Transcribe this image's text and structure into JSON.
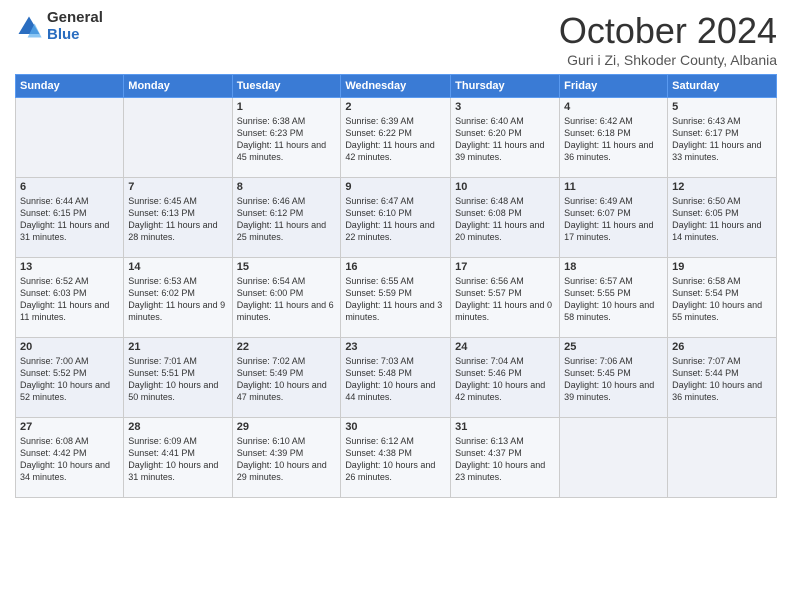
{
  "logo": {
    "general": "General",
    "blue": "Blue"
  },
  "header": {
    "month": "October 2024",
    "location": "Guri i Zi, Shkoder County, Albania"
  },
  "days_of_week": [
    "Sunday",
    "Monday",
    "Tuesday",
    "Wednesday",
    "Thursday",
    "Friday",
    "Saturday"
  ],
  "weeks": [
    [
      {
        "day": "",
        "info": ""
      },
      {
        "day": "",
        "info": ""
      },
      {
        "day": "1",
        "info": "Sunrise: 6:38 AM\nSunset: 6:23 PM\nDaylight: 11 hours and 45 minutes."
      },
      {
        "day": "2",
        "info": "Sunrise: 6:39 AM\nSunset: 6:22 PM\nDaylight: 11 hours and 42 minutes."
      },
      {
        "day": "3",
        "info": "Sunrise: 6:40 AM\nSunset: 6:20 PM\nDaylight: 11 hours and 39 minutes."
      },
      {
        "day": "4",
        "info": "Sunrise: 6:42 AM\nSunset: 6:18 PM\nDaylight: 11 hours and 36 minutes."
      },
      {
        "day": "5",
        "info": "Sunrise: 6:43 AM\nSunset: 6:17 PM\nDaylight: 11 hours and 33 minutes."
      }
    ],
    [
      {
        "day": "6",
        "info": "Sunrise: 6:44 AM\nSunset: 6:15 PM\nDaylight: 11 hours and 31 minutes."
      },
      {
        "day": "7",
        "info": "Sunrise: 6:45 AM\nSunset: 6:13 PM\nDaylight: 11 hours and 28 minutes."
      },
      {
        "day": "8",
        "info": "Sunrise: 6:46 AM\nSunset: 6:12 PM\nDaylight: 11 hours and 25 minutes."
      },
      {
        "day": "9",
        "info": "Sunrise: 6:47 AM\nSunset: 6:10 PM\nDaylight: 11 hours and 22 minutes."
      },
      {
        "day": "10",
        "info": "Sunrise: 6:48 AM\nSunset: 6:08 PM\nDaylight: 11 hours and 20 minutes."
      },
      {
        "day": "11",
        "info": "Sunrise: 6:49 AM\nSunset: 6:07 PM\nDaylight: 11 hours and 17 minutes."
      },
      {
        "day": "12",
        "info": "Sunrise: 6:50 AM\nSunset: 6:05 PM\nDaylight: 11 hours and 14 minutes."
      }
    ],
    [
      {
        "day": "13",
        "info": "Sunrise: 6:52 AM\nSunset: 6:03 PM\nDaylight: 11 hours and 11 minutes."
      },
      {
        "day": "14",
        "info": "Sunrise: 6:53 AM\nSunset: 6:02 PM\nDaylight: 11 hours and 9 minutes."
      },
      {
        "day": "15",
        "info": "Sunrise: 6:54 AM\nSunset: 6:00 PM\nDaylight: 11 hours and 6 minutes."
      },
      {
        "day": "16",
        "info": "Sunrise: 6:55 AM\nSunset: 5:59 PM\nDaylight: 11 hours and 3 minutes."
      },
      {
        "day": "17",
        "info": "Sunrise: 6:56 AM\nSunset: 5:57 PM\nDaylight: 11 hours and 0 minutes."
      },
      {
        "day": "18",
        "info": "Sunrise: 6:57 AM\nSunset: 5:55 PM\nDaylight: 10 hours and 58 minutes."
      },
      {
        "day": "19",
        "info": "Sunrise: 6:58 AM\nSunset: 5:54 PM\nDaylight: 10 hours and 55 minutes."
      }
    ],
    [
      {
        "day": "20",
        "info": "Sunrise: 7:00 AM\nSunset: 5:52 PM\nDaylight: 10 hours and 52 minutes."
      },
      {
        "day": "21",
        "info": "Sunrise: 7:01 AM\nSunset: 5:51 PM\nDaylight: 10 hours and 50 minutes."
      },
      {
        "day": "22",
        "info": "Sunrise: 7:02 AM\nSunset: 5:49 PM\nDaylight: 10 hours and 47 minutes."
      },
      {
        "day": "23",
        "info": "Sunrise: 7:03 AM\nSunset: 5:48 PM\nDaylight: 10 hours and 44 minutes."
      },
      {
        "day": "24",
        "info": "Sunrise: 7:04 AM\nSunset: 5:46 PM\nDaylight: 10 hours and 42 minutes."
      },
      {
        "day": "25",
        "info": "Sunrise: 7:06 AM\nSunset: 5:45 PM\nDaylight: 10 hours and 39 minutes."
      },
      {
        "day": "26",
        "info": "Sunrise: 7:07 AM\nSunset: 5:44 PM\nDaylight: 10 hours and 36 minutes."
      }
    ],
    [
      {
        "day": "27",
        "info": "Sunrise: 6:08 AM\nSunset: 4:42 PM\nDaylight: 10 hours and 34 minutes."
      },
      {
        "day": "28",
        "info": "Sunrise: 6:09 AM\nSunset: 4:41 PM\nDaylight: 10 hours and 31 minutes."
      },
      {
        "day": "29",
        "info": "Sunrise: 6:10 AM\nSunset: 4:39 PM\nDaylight: 10 hours and 29 minutes."
      },
      {
        "day": "30",
        "info": "Sunrise: 6:12 AM\nSunset: 4:38 PM\nDaylight: 10 hours and 26 minutes."
      },
      {
        "day": "31",
        "info": "Sunrise: 6:13 AM\nSunset: 4:37 PM\nDaylight: 10 hours and 23 minutes."
      },
      {
        "day": "",
        "info": ""
      },
      {
        "day": "",
        "info": ""
      }
    ]
  ]
}
